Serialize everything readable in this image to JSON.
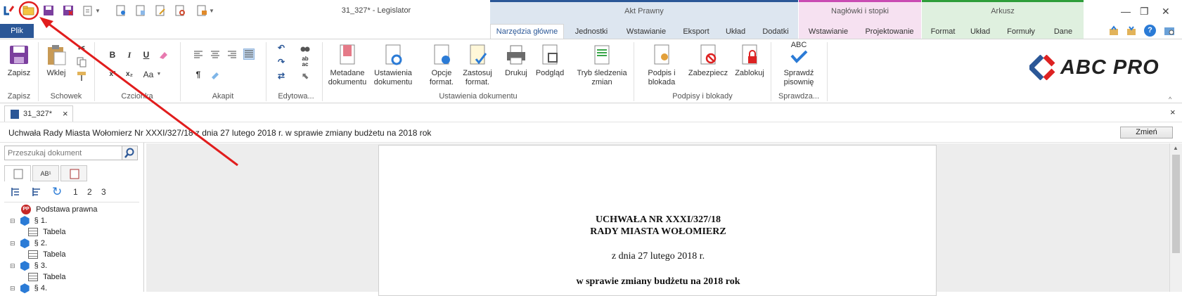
{
  "window": {
    "title": "31_327* - Legislator"
  },
  "context_groups": [
    {
      "label": "Akt Prawny",
      "color": "#2b5797",
      "bg": "#dde6f0"
    },
    {
      "label": "Nagłówki i stopki",
      "color": "#c94bb3",
      "bg": "#f6e1f1"
    },
    {
      "label": "Arkusz",
      "color": "#2e9e3a",
      "bg": "#dff0df"
    }
  ],
  "tabs": {
    "file": "Plik",
    "main": [
      "Narzędzia główne",
      "Jednostki",
      "Wstawianie",
      "Eksport",
      "Układ",
      "Dodatki"
    ],
    "headers": [
      "Wstawianie",
      "Projektowanie"
    ],
    "sheet": [
      "Format",
      "Układ",
      "Formuły",
      "Dane"
    ]
  },
  "ribbon": {
    "save": "Zapisz",
    "paste": "Wklej",
    "font_buttons": {
      "bold": "B",
      "italic": "I",
      "underline": "U",
      "case": "Aa",
      "para": "¶"
    },
    "metadata": "Metadane dokumentu",
    "doc_settings": "Ustawienia dokumentu",
    "format_options": "Opcje format.",
    "apply_format": "Zastosuj format.",
    "print": "Drukuj",
    "preview": "Podgląd",
    "track_changes": "Tryb śledzenia zmian",
    "sign_block": "Podpis i blokada",
    "protect": "Zabezpiecz",
    "lock": "Zablokuj",
    "spellcheck": "Sprawdź pisownię",
    "spell_icon_text": "ABC",
    "groups": {
      "save": "Zapisz",
      "clipboard": "Schowek",
      "font": "Czcionka",
      "paragraph": "Akapit",
      "editing": "Edytowa...",
      "doc_settings": "Ustawienia dokumentu",
      "signatures": "Podpisy i blokady",
      "check": "Sprawdza..."
    },
    "brand": "ABC PRO"
  },
  "document_tab": {
    "label": "31_327*",
    "close": "×"
  },
  "info_bar": {
    "title": "Uchwała Rady Miasta Wołomierz Nr XXXI/327/18 z dnia 27 lutego 2018 r. w sprawie zmiany budżetu na 2018 rok",
    "change_button": "Zmień"
  },
  "panel": {
    "search_placeholder": "Przeszukaj dokument",
    "levels": [
      "1",
      "2",
      "3"
    ],
    "tree": [
      {
        "label": "Podstawa prawna",
        "kind": "pp"
      },
      {
        "label": "§ 1.",
        "kind": "para"
      },
      {
        "label": "Tabela",
        "kind": "table"
      },
      {
        "label": "§ 2.",
        "kind": "para"
      },
      {
        "label": "Tabela",
        "kind": "table"
      },
      {
        "label": "§ 3.",
        "kind": "para"
      },
      {
        "label": "Tabela",
        "kind": "table"
      },
      {
        "label": "§ 4.",
        "kind": "para"
      }
    ],
    "pp_badge": "PP"
  },
  "document": {
    "line1": "UCHWAŁA NR XXXI/327/18",
    "line2": "RADY MIASTA WOŁOMIERZ",
    "line3": "z dnia 27 lutego 2018 r.",
    "line4": "w sprawie zmiany budżetu na 2018 rok"
  }
}
